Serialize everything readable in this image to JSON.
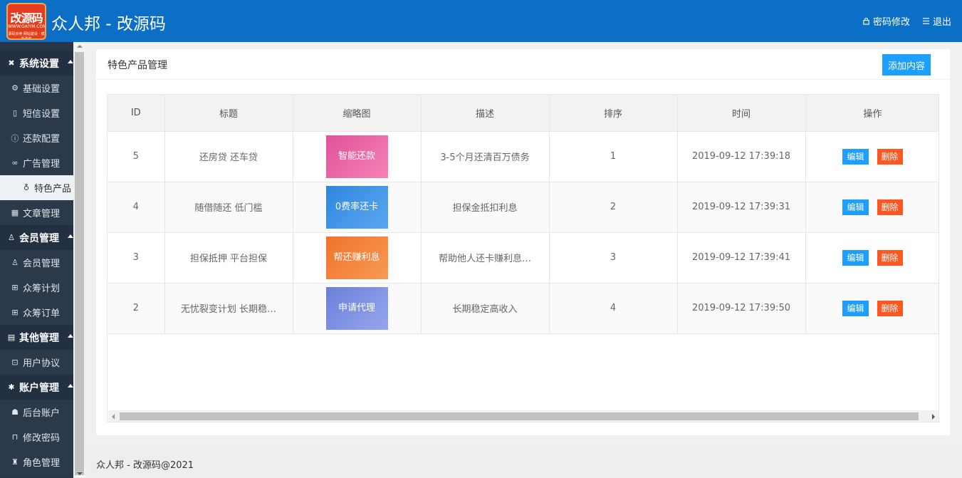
{
  "header": {
    "logo_text": "改源码",
    "logo_sub": "WWW.GAIYM.COM",
    "logo_sub2": "源码买卖 网站建设 · 模板改装",
    "app_title": "众人邦 - 改源码",
    "password_link": "密码修改",
    "logout_link": "退出"
  },
  "sidebar": {
    "groups": [
      {
        "label": "系统设置",
        "icon": "tools-icon",
        "items": [
          {
            "label": "基础设置",
            "icon": "gear-icon"
          },
          {
            "label": "短信设置",
            "icon": "phone-icon"
          },
          {
            "label": "还款配置",
            "icon": "info-icon"
          },
          {
            "label": "广告管理",
            "icon": "link-icon"
          },
          {
            "label": "特色产品",
            "icon": "bell-icon",
            "active": true
          },
          {
            "label": "文章管理",
            "icon": "grid-icon"
          }
        ]
      },
      {
        "label": "会员管理",
        "icon": "users-icon",
        "items": [
          {
            "label": "会员管理",
            "icon": "user-icon"
          },
          {
            "label": "众筹计划",
            "icon": "apps-icon"
          },
          {
            "label": "众筹订单",
            "icon": "apps-icon"
          }
        ]
      },
      {
        "label": "其他管理",
        "icon": "doc-icon",
        "items": [
          {
            "label": "用户协议",
            "icon": "book-icon"
          }
        ]
      },
      {
        "label": "账户管理",
        "icon": "gear-icon",
        "items": [
          {
            "label": "后台账户",
            "icon": "group-icon"
          },
          {
            "label": "修改密码",
            "icon": "lock-icon"
          },
          {
            "label": "角色管理",
            "icon": "role-icon"
          }
        ]
      }
    ]
  },
  "panel": {
    "title": "特色产品管理",
    "add_button": "添加内容"
  },
  "table": {
    "columns": [
      "ID",
      "标题",
      "缩略图",
      "描述",
      "排序",
      "时间",
      "操作"
    ],
    "rows": [
      {
        "id": "5",
        "title": "还房贷 还车贷",
        "thumb_text": "智能还款",
        "thumb_color": "#f06aa6",
        "desc": "3-5个月还清百万债务",
        "sort": "1",
        "time": "2019-09-12 17:39:18"
      },
      {
        "id": "4",
        "title": "随借随还 低门槛",
        "thumb_text": "0费率还卡",
        "thumb_color": "#3d94e8",
        "desc": "担保金抵扣利息",
        "sort": "2",
        "time": "2019-09-12 17:39:31"
      },
      {
        "id": "3",
        "title": "担保抵押 平台担保",
        "thumb_text": "帮还赚利息",
        "thumb_color": "#f4813e",
        "desc": "帮助他人还卡赚利息…",
        "sort": "3",
        "time": "2019-09-12 17:39:41"
      },
      {
        "id": "2",
        "title": "无忧裂变计划 长期稳…",
        "thumb_text": "申请代理",
        "thumb_color": "#7b8fe0",
        "desc": "长期稳定高收入",
        "sort": "4",
        "time": "2019-09-12 17:39:50"
      }
    ],
    "edit_label": "编辑",
    "delete_label": "删除"
  },
  "footer": {
    "text": "众人邦 - 改源码@2021"
  }
}
